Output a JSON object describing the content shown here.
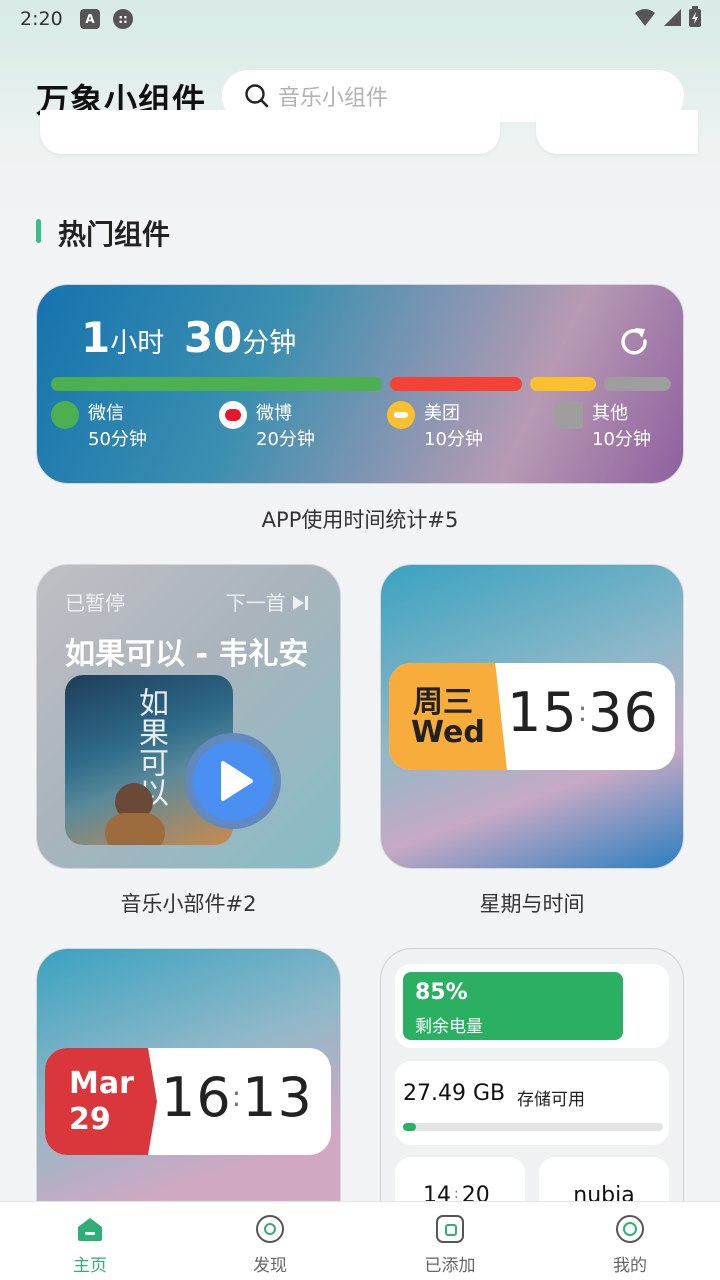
{
  "status_bar": {
    "time": "2:20"
  },
  "header": {
    "app_title": "万象小组件",
    "search_placeholder": "音乐小组件"
  },
  "section": {
    "title": "热门组件"
  },
  "usage_widget": {
    "total_hours": "1",
    "hours_unit": "小时",
    "total_minutes": "30",
    "minutes_unit": "分钟",
    "caption": "APP使用时间统计#5",
    "apps": [
      {
        "name": "微信",
        "time": "50分钟",
        "color": "#4caf50",
        "share": 0.5556
      },
      {
        "name": "微博",
        "time": "20分钟",
        "color": "#f44336",
        "share": 0.2222
      },
      {
        "name": "美团",
        "time": "10分钟",
        "color": "#fbc02d",
        "share": 0.1111
      },
      {
        "name": "其他",
        "time": "10分钟",
        "color": "#9e9e9e",
        "share": 0.1111
      }
    ]
  },
  "music_widget": {
    "state": "已暂停",
    "next": "下一首",
    "song": "如果可以 - 韦礼安",
    "album_text": "如果可以",
    "caption": "音乐小部件#2"
  },
  "weekday_widget": {
    "weekday_cn": "周三",
    "weekday_en": "Wed",
    "hour": "15",
    "minute": "36",
    "caption": "星期与时间"
  },
  "date_widget": {
    "month": "Mar",
    "day": "29",
    "hour": "16",
    "minute": "13"
  },
  "system_widget": {
    "battery": "85%",
    "battery_label": "剩余电量",
    "storage": "27.49 GB",
    "storage_label": "存储可用",
    "storage_used_fraction": 0.05,
    "clock_hour": "14",
    "clock_minute": "20",
    "brand": "nubia"
  },
  "bottom_nav": {
    "tabs": [
      {
        "label": "主页",
        "active": true
      },
      {
        "label": "发现",
        "active": false
      },
      {
        "label": "已添加",
        "active": false
      },
      {
        "label": "我的",
        "active": false
      }
    ]
  },
  "colors": {
    "accent": "#2fae7a",
    "weekday_tag": "#f8ac3b",
    "date_tag": "#d9373b",
    "battery": "#2bb063",
    "play_button": "#4a8ff2"
  }
}
